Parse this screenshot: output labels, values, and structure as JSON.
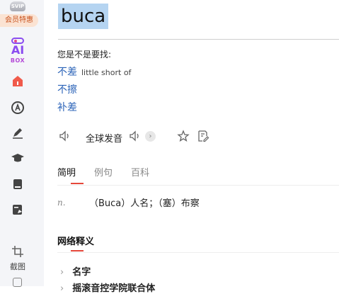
{
  "sidebar": {
    "svip_badge": "SVIP",
    "vip_label": "会员特惠",
    "ai_label": "AI",
    "box_label": "BOX",
    "items": [
      {
        "name": "home-icon"
      },
      {
        "name": "translate-icon"
      },
      {
        "name": "pen-icon"
      },
      {
        "name": "graduation-cap-icon"
      },
      {
        "name": "book-icon"
      },
      {
        "name": "document-edit-icon"
      }
    ],
    "crop_label": "截图"
  },
  "entry": {
    "word": "buca",
    "suggest_title": "您是不是要找:",
    "suggestions": [
      {
        "word": "不差",
        "note": "little short of"
      },
      {
        "word": "不擦",
        "note": ""
      },
      {
        "word": "补差",
        "note": ""
      }
    ],
    "pron_label": "全球发音"
  },
  "tabs": [
    {
      "label": "简明",
      "active": true
    },
    {
      "label": "例句",
      "active": false
    },
    {
      "label": "百科",
      "active": false
    }
  ],
  "definition": {
    "pos": "n.",
    "text": "（Buca）人名；（塞）布察"
  },
  "network": {
    "title": "网络释义",
    "items": [
      "名字",
      "摇滚音控学院联合体"
    ]
  },
  "colors": {
    "accent": "#e5483b",
    "link": "#2c64b8",
    "highlight": "#b5d4f1",
    "ai_purple": "#8a4cf0"
  }
}
